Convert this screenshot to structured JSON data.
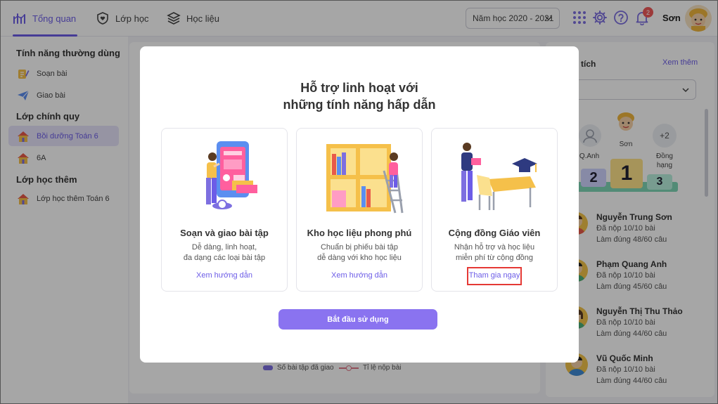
{
  "nav": {
    "tabs": [
      {
        "label": "Tổng quan",
        "icon": "chart-icon",
        "active": true
      },
      {
        "label": "Lớp học",
        "icon": "shield-heart-icon",
        "active": false
      },
      {
        "label": "Học liệu",
        "icon": "stack-icon",
        "active": false
      }
    ],
    "school_year": "Năm học 2020 - 2021",
    "notification_count": "2",
    "user_name": "Sơn",
    "icons": [
      "apps-grid-icon",
      "gear-icon",
      "help-icon",
      "bell-icon"
    ]
  },
  "sidebar": {
    "sections": [
      {
        "title": "Tính năng thường dùng",
        "items": [
          {
            "label": "Soạn bài",
            "icon": "compose-icon"
          },
          {
            "label": "Giao bài",
            "icon": "paper-plane-icon"
          }
        ]
      },
      {
        "title": "Lớp chính quy",
        "items": [
          {
            "label": "Bồi dưỡng Toán 6",
            "icon": "house-icon",
            "active": true
          },
          {
            "label": "6A",
            "icon": "house-icon"
          }
        ]
      },
      {
        "title": "Lớp học thêm",
        "items": [
          {
            "label": "Lớp học thêm Toán 6",
            "icon": "house-icon"
          }
        ]
      }
    ]
  },
  "chart_legend": {
    "bar_label": "Số bài tập đã giao",
    "line_label": "Tỉ lệ nộp bài"
  },
  "right_panel": {
    "title": "tích",
    "more_link": "Xem thêm",
    "podium": {
      "first": {
        "name": "Sơn",
        "rank": "1"
      },
      "second": {
        "name": "Q.Anh",
        "rank": "2"
      },
      "third": {
        "rank": "3"
      },
      "tie": {
        "count": "+2",
        "label_line1": "Đồng",
        "label_line2": "hạng"
      }
    },
    "students": [
      {
        "name": "Nguyễn Trung Sơn",
        "submitted": "Đã nộp 10/10 bài",
        "correct": "Làm đúng 48/60 câu"
      },
      {
        "name": "Phạm Quang Anh",
        "submitted": "Đã nộp 10/10 bài",
        "correct": "Làm đúng 45/60 câu"
      },
      {
        "name": "Nguyễn Thị Thu Thảo",
        "submitted": "Đã nộp 10/10 bài",
        "correct": "Làm đúng 44/60 câu"
      },
      {
        "name": "Vũ Quốc Minh",
        "submitted": "Đã nộp 10/10 bài",
        "correct": "Làm đúng 44/60 câu"
      }
    ]
  },
  "modal": {
    "title_line1": "Hỗ trợ linh hoạt với",
    "title_line2": "những tính năng hấp dẫn",
    "cards": [
      {
        "title": "Soạn và giao bài tập",
        "desc_line1": "Dễ dàng, linh hoạt,",
        "desc_line2": "đa dạng các loại bài tập",
        "link": "Xem hướng dẫn"
      },
      {
        "title": "Kho học liệu phong phú",
        "desc_line1": "Chuẩn bị phiếu bài tập",
        "desc_line2": "dễ dàng với kho học liệu",
        "link": "Xem hướng dẫn"
      },
      {
        "title": "Cộng đồng Giáo viên",
        "desc_line1": "Nhận hỗ trợ và học liệu",
        "desc_line2": "miễn phí từ cộng đồng",
        "link": "Tham gia ngay"
      }
    ],
    "start_button": "Bắt đầu sử dụng",
    "colors": {
      "accent": "#6c5ce7",
      "button": "#8a73f0",
      "highlight": "#e53935"
    }
  }
}
